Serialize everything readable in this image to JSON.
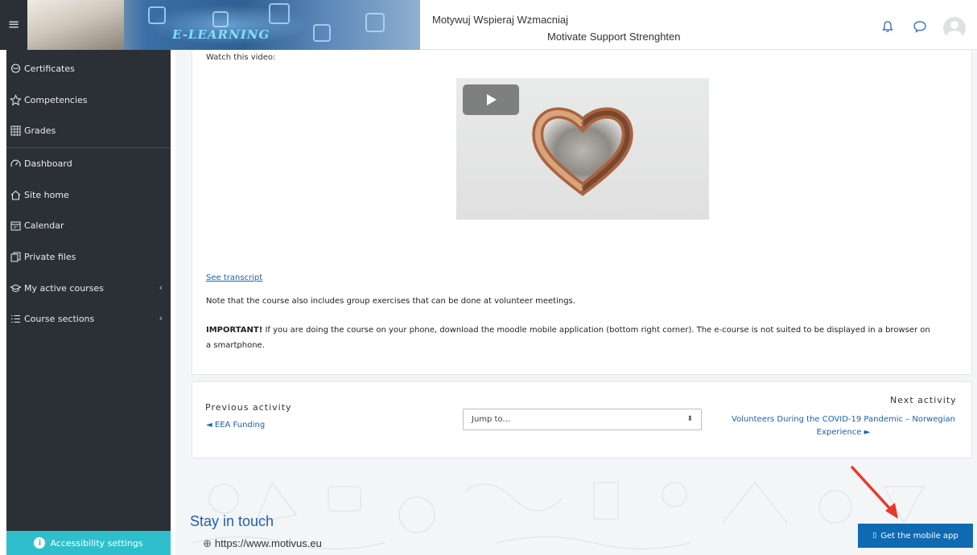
{
  "header": {
    "menu_icon": "hamburger-icon",
    "banner_text": "E-LEARNING",
    "site_title_pl": "Motywuj Wspieraj Wzmacniaj",
    "site_title_en": "Motivate Support Strenghten",
    "icons": [
      "bell-icon",
      "chat-icon",
      "avatar"
    ]
  },
  "sidebar": {
    "items": [
      {
        "label": "Certificates",
        "icon": "certificate-icon"
      },
      {
        "label": "Competencies",
        "icon": "star-icon"
      },
      {
        "label": "Grades",
        "icon": "grades-icon"
      },
      {
        "label": "Dashboard",
        "icon": "dashboard-icon"
      },
      {
        "label": "Site home",
        "icon": "home-icon"
      },
      {
        "label": "Calendar",
        "icon": "calendar-icon"
      },
      {
        "label": "Private files",
        "icon": "files-icon"
      },
      {
        "label": "My active courses",
        "icon": "graduation-cap-icon"
      },
      {
        "label": "Course sections",
        "icon": "list-icon"
      }
    ],
    "accessibility_label": "Accessibility settings"
  },
  "content": {
    "watch_label": "Watch this video:",
    "transcript_link": "See transcript",
    "note": "Note that the course also includes group exercises that can be done at volunteer meetings.",
    "important_bold": "IMPORTANT!",
    "important_text": " If you are doing the course on your phone, download the moodle mobile application (bottom right corner). The e-course is not suited to be displayed in a browser on a smartphone."
  },
  "activity_nav": {
    "previous_label": "Previous activity",
    "previous_link": "◄ EEA Funding",
    "jump_placeholder": "Jump to...",
    "next_label": "Next activity",
    "next_link": "Volunteers During the COVID-19 Pandemic – Norwegian Experience ►"
  },
  "footer": {
    "stay_in_touch": "Stay in touch",
    "website": "https://www.motivus.eu",
    "mobile_app_button": "Get the mobile app"
  },
  "colors": {
    "sidebar_bg": "#2b3036",
    "accessibility_bg": "#2fbecc",
    "link": "#1f5fb2",
    "mobile_button_bg": "#0f6ab2",
    "annotation_arrow": "#e8382c"
  }
}
